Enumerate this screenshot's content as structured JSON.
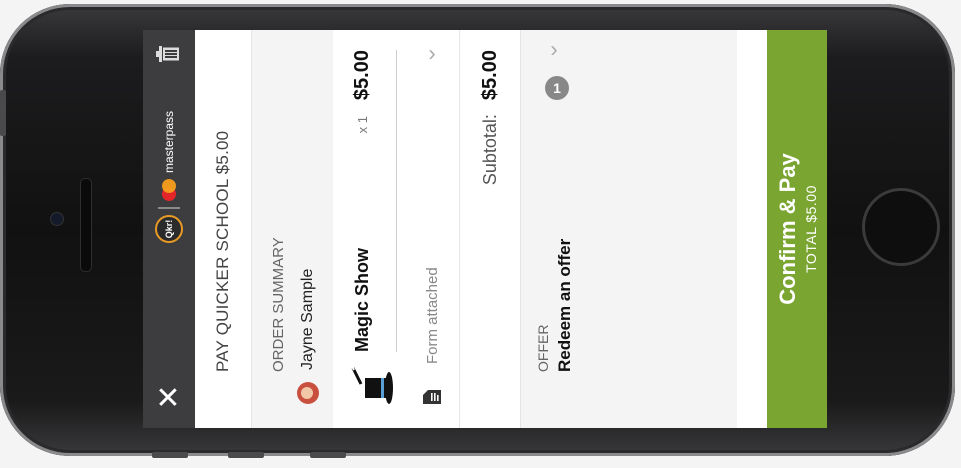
{
  "header": {
    "qkr_logo_text": "Qkr!",
    "masterpass_text": "masterpass",
    "close_icon": "close-icon",
    "trash_icon": "trash-icon"
  },
  "pay_title": "PAY QUICKER SCHOOL $5.00",
  "order_summary": {
    "label": "ORDER SUMMARY",
    "user_name": "Jayne Sample"
  },
  "item": {
    "name": "Magic Show",
    "qty": "x 1",
    "price": "$5.00",
    "form_text": "Form attached"
  },
  "subtotal": {
    "label": "Subtotal:",
    "value": "$5.00"
  },
  "offer": {
    "label": "OFFER",
    "text": "Redeem an offer",
    "badge": "1"
  },
  "confirm": {
    "label": "Confirm & Pay",
    "total": "TOTAL $5.00"
  },
  "colors": {
    "accent_green": "#79a530",
    "topbar": "#3d3d40",
    "masterpass_red": "#e3262a",
    "masterpass_orange": "#f59e1c"
  }
}
